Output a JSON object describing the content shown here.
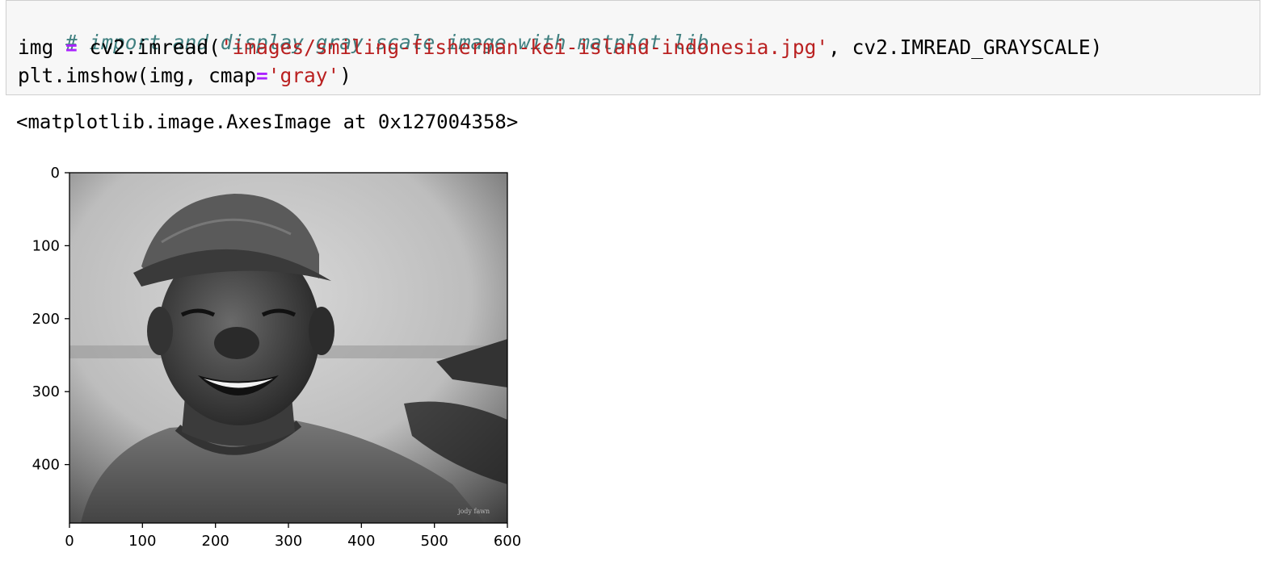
{
  "code_cell": {
    "comment": "# import and display gray scale image with matplot lib",
    "line2": {
      "var": "img",
      "op": "=",
      "call_start": "cv2.imread(",
      "path": "'images/smiling-fisherman-kei-island-indonesia.jpg'",
      "call_end": ", cv2.IMREAD_GRAYSCALE)"
    },
    "line3": {
      "call_start": "plt.imshow(img, cmap",
      "op": "=",
      "arg": "'gray'",
      "call_end": ")"
    }
  },
  "output": {
    "repr": "<matplotlib.image.AxesImage at 0x127004358>"
  },
  "plot": {
    "x_ticks": [
      "0",
      "100",
      "200",
      "300",
      "400",
      "500",
      "600"
    ],
    "y_ticks": [
      "0",
      "100",
      "200",
      "300",
      "400"
    ],
    "image_subject": "grayscale photo of smiling fisherman wearing cap",
    "watermark": "jody fawn"
  }
}
